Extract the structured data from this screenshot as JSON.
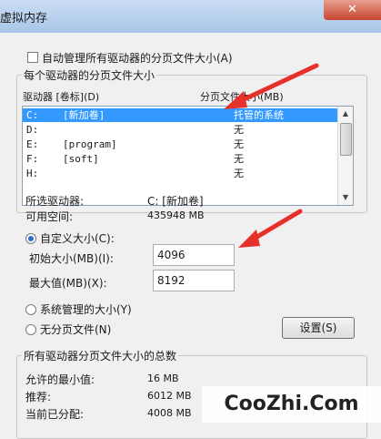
{
  "window": {
    "title": "虚拟内存",
    "close_glyph": "✕"
  },
  "auto_manage": {
    "label": "自动管理所有驱动器的分页文件大小(A)",
    "checked": false
  },
  "per_drive": {
    "group_label": "每个驱动器的分页文件大小",
    "col_drive": "驱动器 [卷标](D)",
    "col_size": "分页文件大小(MB)",
    "rows": [
      {
        "drive": "C:",
        "label": "[新加卷]",
        "size": "托管的系统",
        "selected": true
      },
      {
        "drive": "D:",
        "label": "",
        "size": "无",
        "selected": false
      },
      {
        "drive": "E:",
        "label": "[program]",
        "size": "无",
        "selected": false
      },
      {
        "drive": "F:",
        "label": "[soft]",
        "size": "无",
        "selected": false
      },
      {
        "drive": "H:",
        "label": "",
        "size": "无",
        "selected": false
      }
    ]
  },
  "selected_drive": {
    "label": "所选驱动器:",
    "value": "C:  [新加卷]"
  },
  "free_space": {
    "label": "可用空间:",
    "value": "435948 MB"
  },
  "custom_size": {
    "label": "自定义大小(C):",
    "selected": true
  },
  "initial_size": {
    "label": "初始大小(MB)(I):",
    "value": "4096"
  },
  "max_size": {
    "label": "最大值(MB)(X):",
    "value": "8192"
  },
  "system_managed": {
    "label": "系统管理的大小(Y)",
    "selected": false
  },
  "no_paging": {
    "label": "无分页文件(N)",
    "selected": false
  },
  "set_button": {
    "label": "设置(S)"
  },
  "totals": {
    "group_label": "所有驱动器分页文件大小的总数",
    "min_label": "允许的最小值:",
    "min_value": "16 MB",
    "recommended_label": "推荐:",
    "recommended_value": "6012 MB",
    "current_label": "当前已分配:",
    "current_value": "4008 MB"
  },
  "watermark": {
    "text": "CooZhi.Com"
  },
  "colors": {
    "annotation_arrow": "#e8302a",
    "selection": "#3399ff"
  }
}
